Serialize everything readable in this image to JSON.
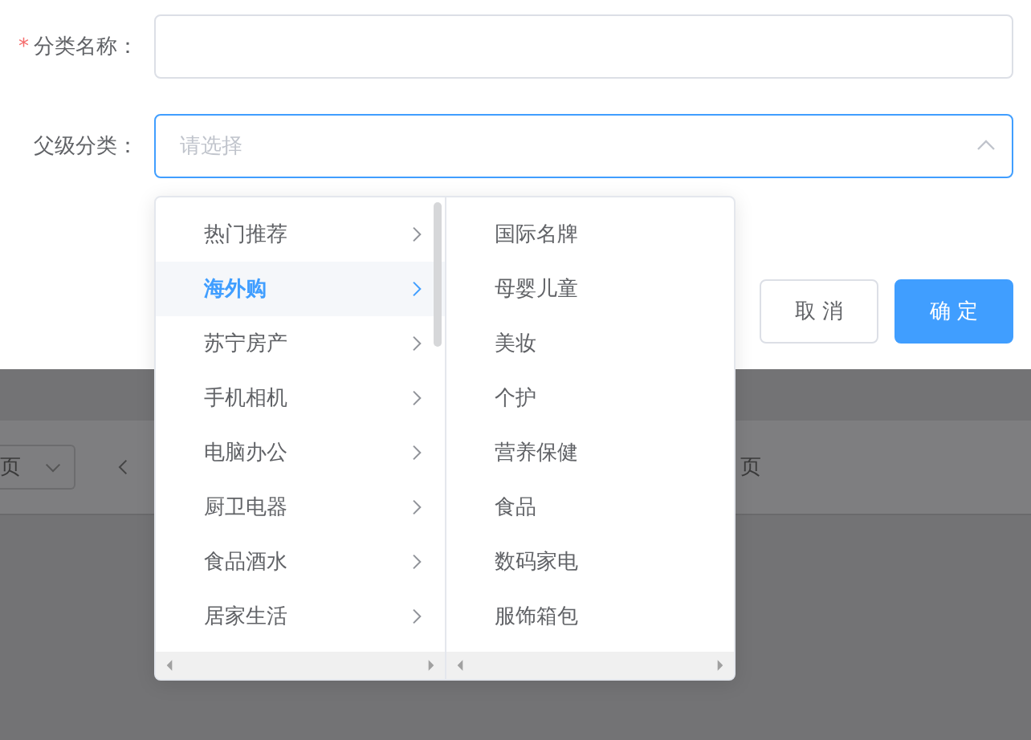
{
  "form": {
    "fields": [
      {
        "label": "分类名称：",
        "required_mark": "*",
        "kind": "text",
        "focused": false
      },
      {
        "label": "父级分类：",
        "kind": "select",
        "placeholder": "请选择",
        "focused": true,
        "expanded": true
      }
    ]
  },
  "buttons": [
    {
      "label": "取 消",
      "kind": "default"
    },
    {
      "label": "确 定",
      "kind": "primary"
    }
  ],
  "background_pagination": {
    "page_size": "页",
    "jump_suffix": "页"
  },
  "cascader": {
    "menus": [
      {
        "items": [
          {
            "label": "热门推荐",
            "selected": false,
            "has_children": true
          },
          {
            "label": "海外购",
            "selected": true,
            "has_children": true
          },
          {
            "label": "苏宁房产",
            "selected": false,
            "has_children": true
          },
          {
            "label": "手机相机",
            "selected": false,
            "has_children": true
          },
          {
            "label": "电脑办公",
            "selected": false,
            "has_children": true
          },
          {
            "label": "厨卫电器",
            "selected": false,
            "has_children": true
          },
          {
            "label": "食品酒水",
            "selected": false,
            "has_children": true
          },
          {
            "label": "居家生活",
            "selected": false,
            "has_children": true
          }
        ]
      },
      {
        "items": [
          {
            "label": "国际名牌",
            "selected": false,
            "has_children": false
          },
          {
            "label": "母婴儿童",
            "selected": false,
            "has_children": false
          },
          {
            "label": "美妆",
            "selected": false,
            "has_children": false
          },
          {
            "label": "个护",
            "selected": false,
            "has_children": false
          },
          {
            "label": "营养保健",
            "selected": false,
            "has_children": false
          },
          {
            "label": "食品",
            "selected": false,
            "has_children": false
          },
          {
            "label": "数码家电",
            "selected": false,
            "has_children": false
          },
          {
            "label": "服饰箱包",
            "selected": false,
            "has_children": false
          }
        ]
      }
    ]
  }
}
